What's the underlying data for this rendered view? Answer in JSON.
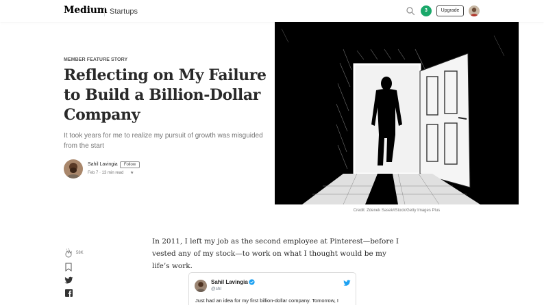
{
  "header": {
    "logo": "Medium",
    "publication": "Startups",
    "notification_count": "3",
    "upgrade_label": "Upgrade",
    "icons": {
      "search": "search-icon",
      "avatar": "user-avatar"
    }
  },
  "article": {
    "kicker": "MEMBER FEATURE STORY",
    "title": "Reflecting on My Failure to Build a Billion-Dollar Company",
    "subtitle": "It took years for me to realize my pursuit of growth was misguided from the start",
    "author": {
      "name": "Sahil Lavingia",
      "follow_label": "Follow",
      "meta": "Feb 7 · 13 min read",
      "star": "★"
    },
    "image_credit": "Credit: Zdenek Sasek/iStock/Getty Images Plus",
    "body_paragraph": "In 2011, I left my job as the second employee at Pinterest—before I vested any of my stock—to work on what I thought would be my life’s work."
  },
  "side_actions": {
    "clap_count": "58K",
    "icons": [
      "clap-icon",
      "bookmark-icon",
      "twitter-icon",
      "facebook-icon"
    ]
  },
  "tweet": {
    "name": "Sahil Lavingia",
    "handle": "@shl",
    "text": "Just had an idea for my first billion-dollar company. Tomorrow, I"
  },
  "colors": {
    "accent_green": "#1aa86a",
    "twitter_blue": "#1da1f2",
    "text": "#292929",
    "muted": "#757575"
  }
}
